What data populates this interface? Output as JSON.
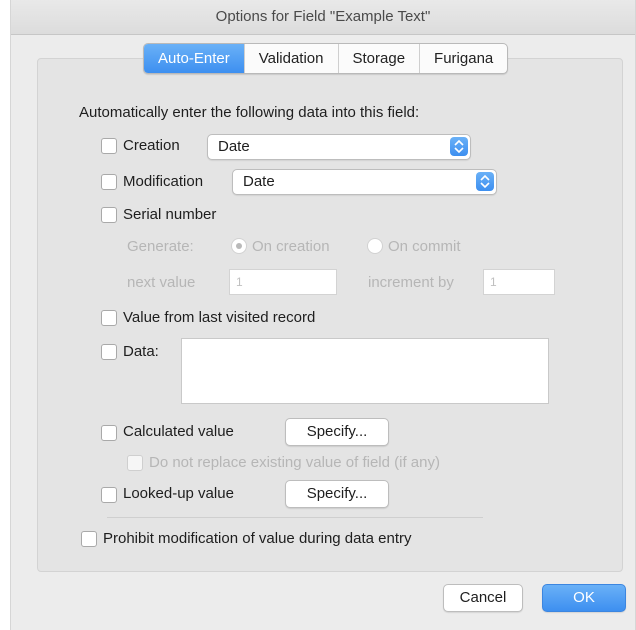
{
  "window": {
    "title": "Options for Field \"Example Text\""
  },
  "tabs": [
    "Auto-Enter",
    "Validation",
    "Storage",
    "Furigana"
  ],
  "auto_enter": {
    "intro": "Automatically enter the following data into this field:",
    "creation": {
      "label": "Creation",
      "value": "Date"
    },
    "modification": {
      "label": "Modification",
      "value": "Date"
    },
    "serial": {
      "label": "Serial number",
      "generate_label": "Generate:",
      "on_creation": "On creation",
      "on_commit": "On commit",
      "next_value_label": "next value",
      "next_value": "1",
      "increment_label": "increment by",
      "increment": "1"
    },
    "last_visited": {
      "label": "Value from last visited record"
    },
    "data": {
      "label": "Data:",
      "value": ""
    },
    "calculated": {
      "label": "Calculated value",
      "specify": "Specify...",
      "no_replace": "Do not replace existing value of field (if any)"
    },
    "looked_up": {
      "label": "Looked-up value",
      "specify": "Specify..."
    },
    "prohibit": "Prohibit modification of value during data entry"
  },
  "buttons": {
    "cancel": "Cancel",
    "ok": "OK"
  },
  "colors": {
    "accent": "#3d8ff0",
    "window_bg": "#ececec",
    "disabled_text": "#b6b6b6"
  }
}
